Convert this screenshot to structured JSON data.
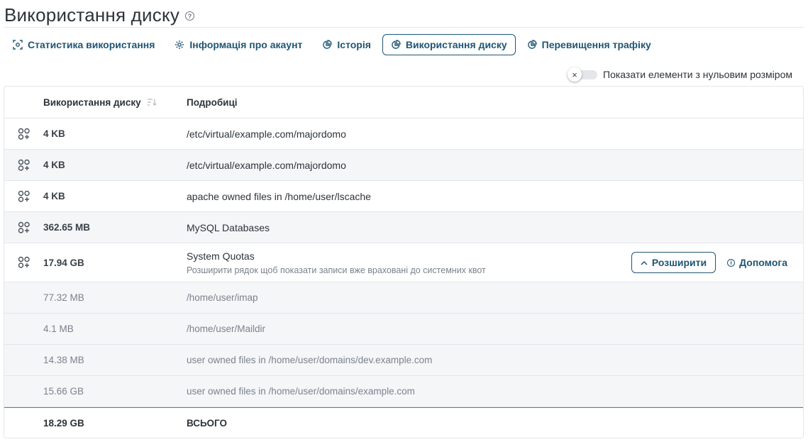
{
  "page": {
    "title": "Використання диску"
  },
  "tabs": [
    {
      "label": "Статистика використання",
      "icon": "stats-icon",
      "active": false
    },
    {
      "label": "Інформація про акаунт",
      "icon": "gear-icon",
      "active": false
    },
    {
      "label": "Історія",
      "icon": "pie-chart-icon",
      "active": false
    },
    {
      "label": "Використання диску",
      "icon": "pie-chart-icon",
      "active": true
    },
    {
      "label": "Перевищення трафіку",
      "icon": "pie-chart-icon",
      "active": false
    }
  ],
  "toggle": {
    "label": "Показати елементи з нульовим розміром",
    "checked": false
  },
  "table": {
    "headers": {
      "size": "Використання диску",
      "details": "Подробиці"
    },
    "rows": [
      {
        "size": "4 KB",
        "detail": "/etc/virtual/example.com/majordomo"
      },
      {
        "size": "4 KB",
        "detail": "/etc/virtual/example.com/majordomo"
      },
      {
        "size": "4 KB",
        "detail": "apache owned files in /home/user/lscache"
      },
      {
        "size": "362.65 MB",
        "detail": "MySQL Databases"
      }
    ],
    "quota": {
      "size": "17.94 GB",
      "title": "System Quotas",
      "description": "Розширити рядок щоб показати записи вже враховані до системних квот",
      "expand_label": "Розширити",
      "help_label": "Допомога"
    },
    "sub_rows": [
      {
        "size": "77.32 MB",
        "detail": "/home/user/imap"
      },
      {
        "size": "4.1 MB",
        "detail": "/home/user/Maildir"
      },
      {
        "size": "14.38 MB",
        "detail": "user owned files in /home/user/domains/dev.example.com"
      },
      {
        "size": "15.66 GB",
        "detail": "user owned files in /home/user/domains/example.com"
      }
    ],
    "total": {
      "size": "18.29 GB",
      "label": "ВСЬОГО"
    }
  },
  "colors": {
    "accent": "#1f5574",
    "total_border": "#2a8fa0",
    "stripe": "#f5f6f8"
  }
}
